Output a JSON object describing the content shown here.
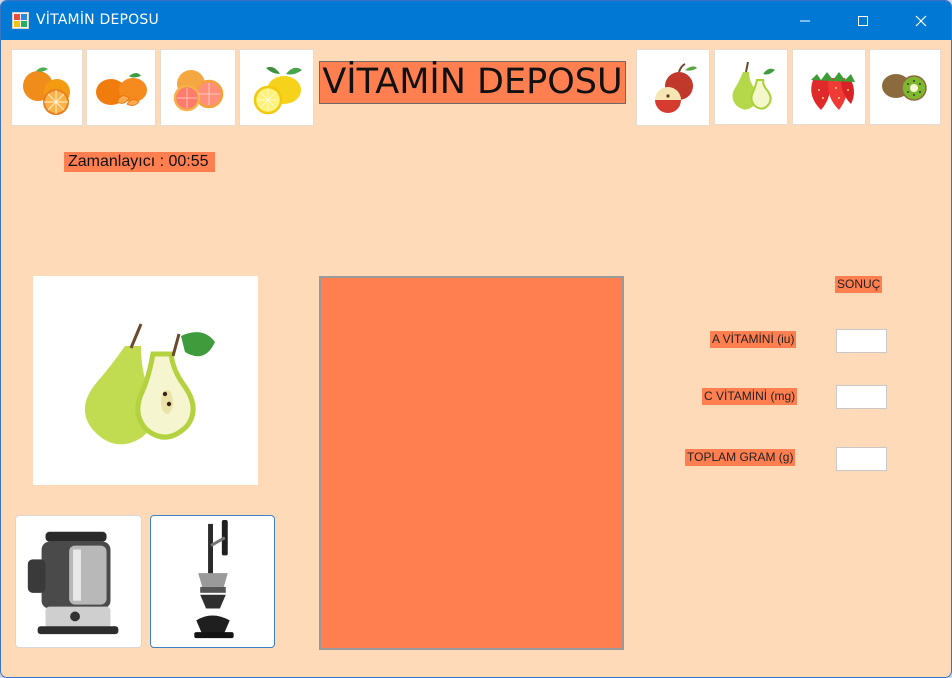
{
  "window": {
    "title": "VİTAMİN DEPOSU",
    "controls": {
      "minimize_icon": "minimize-icon",
      "maximize_icon": "maximize-icon",
      "close_icon": "close-icon"
    }
  },
  "header": {
    "title": "VİTAMİN DEPOSU",
    "left_fruits": [
      "orange",
      "tangerine",
      "grapefruit",
      "lemon"
    ],
    "right_fruits": [
      "apple",
      "pear",
      "strawberry",
      "kiwi"
    ]
  },
  "timer": {
    "text": "Zamanlayıcı : 00:55"
  },
  "preview": {
    "fruit": "pear"
  },
  "machines": [
    "electric-juicer",
    "manual-press-juicer"
  ],
  "results": {
    "title": "SONUÇ",
    "rows": [
      {
        "label": "A VİTAMİNİ (iu)",
        "value": ""
      },
      {
        "label": "C VİTAMİNİ (mg)",
        "value": ""
      },
      {
        "label": "TOPLAM GRAM (g)",
        "value": ""
      }
    ]
  },
  "colors": {
    "background": "#ffdab9",
    "accent": "#ff7f50",
    "titlebar": "#0078d4"
  }
}
